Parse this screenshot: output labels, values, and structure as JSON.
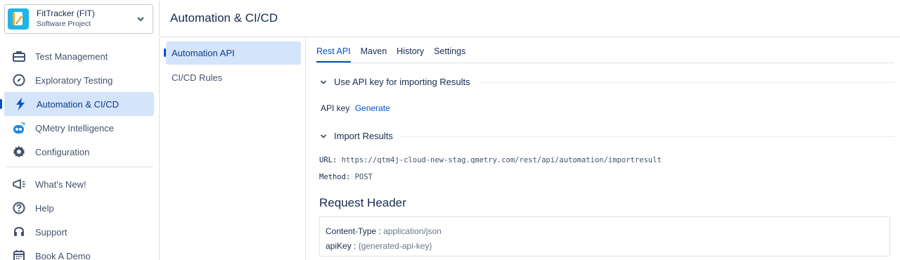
{
  "project": {
    "name": "FitTracker (FIT)",
    "type": "Software Project"
  },
  "sidebar": {
    "items": [
      {
        "label": "Test Management",
        "icon": "briefcase-icon"
      },
      {
        "label": "Exploratory Testing",
        "icon": "compass-icon"
      },
      {
        "label": "Automation & CI/CD",
        "icon": "lightning-icon",
        "active": true
      },
      {
        "label": "QMetry Intelligence",
        "icon": "bot-icon"
      },
      {
        "label": "Configuration",
        "icon": "gear-icon"
      }
    ],
    "secondary": [
      {
        "label": "What's New!",
        "icon": "megaphone-icon"
      },
      {
        "label": "Help",
        "icon": "help-icon"
      },
      {
        "label": "Support",
        "icon": "headset-icon"
      },
      {
        "label": "Book A Demo",
        "icon": "calendar-icon"
      }
    ]
  },
  "header": {
    "title": "Automation & CI/CD"
  },
  "subnav": {
    "items": [
      {
        "label": "Automation API",
        "active": true
      },
      {
        "label": "CI/CD Rules"
      }
    ]
  },
  "tabs": [
    {
      "label": "Rest API",
      "active": true
    },
    {
      "label": "Maven"
    },
    {
      "label": "History"
    },
    {
      "label": "Settings"
    }
  ],
  "sections": {
    "api_key": {
      "title": "Use API key for importing Results",
      "label": "API key",
      "action": "Generate"
    },
    "import": {
      "title": "Import Results",
      "url_label": "URL:",
      "url": "https://qtm4j-cloud-new-stag.qmetry.com/rest/api/automation/importresult",
      "method_label": "Method:",
      "method": "POST"
    }
  },
  "request_header": {
    "title": "Request Header",
    "rows": [
      {
        "key": "Content-Type :",
        "value": "application/json"
      },
      {
        "key": "apiKey :",
        "value": "{generated-api-key}"
      }
    ]
  },
  "colors": {
    "accent": "#0052cc",
    "active_bg": "#d4e4fb",
    "project_icon": "#1fb4e8"
  }
}
